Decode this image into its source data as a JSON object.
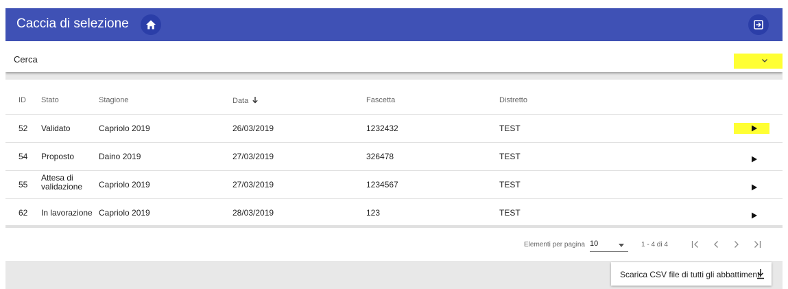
{
  "app": {
    "title": "Caccia di selezione",
    "home_icon": "home-icon",
    "logout_icon": "logout-icon",
    "toolbar_color": "#3f51b5"
  },
  "search": {
    "label": "Cerca",
    "expand_icon": "chevron-down-icon",
    "highlight_color": "#ffff33"
  },
  "table": {
    "columns": {
      "id": "ID",
      "stato": "Stato",
      "stagione": "Stagione",
      "data": "Data",
      "fascetta": "Fascetta",
      "distretto": "Distretto"
    },
    "sort_icon": "arrow-down-icon",
    "rows": [
      {
        "id": "52",
        "stato_1": "Validato",
        "stato_2": "",
        "stagione": "Capriolo 2019",
        "data": "26/03/2019",
        "fascetta": "1232432",
        "distretto": "TEST"
      },
      {
        "id": "54",
        "stato_1": "Proposto",
        "stato_2": "",
        "stagione": "Daino 2019",
        "data": "27/03/2019",
        "fascetta": "326478",
        "distretto": "TEST"
      },
      {
        "id": "55",
        "stato_1": "Attesa di",
        "stato_2": "validazione",
        "stagione": "Capriolo 2019",
        "data": "27/03/2019",
        "fascetta": "1234567",
        "distretto": "TEST"
      },
      {
        "id": "62",
        "stato_1": "In lavorazione",
        "stato_2": "",
        "stagione": "Capriolo 2019",
        "data": "28/03/2019",
        "fascetta": "123",
        "distretto": "TEST"
      }
    ],
    "row_action_icon": "play-icon"
  },
  "paginator": {
    "items_per_page_label": "Elementi per pagina",
    "page_size": "10",
    "range_label": "1 - 4 di 4"
  },
  "download": {
    "label": "Scarica CSV file di tutti gli abbattimenti",
    "icon": "download-icon"
  }
}
